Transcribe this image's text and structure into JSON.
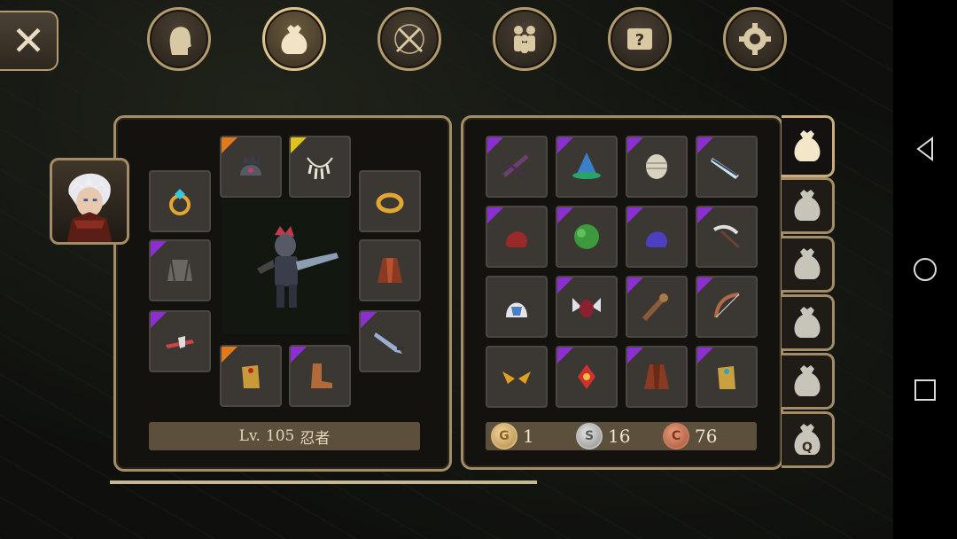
{
  "top_tabs": [
    {
      "name": "character-tab",
      "icon": "head-icon",
      "active": false
    },
    {
      "name": "inventory-tab",
      "icon": "bag-icon",
      "active": true
    },
    {
      "name": "skills-tab",
      "icon": "crossed-swords-icon",
      "active": false
    },
    {
      "name": "social-tab",
      "icon": "people-icon",
      "active": false
    },
    {
      "name": "quest-tab",
      "icon": "scroll-question-icon",
      "active": false
    },
    {
      "name": "settings-tab",
      "icon": "gear-icon",
      "active": false
    }
  ],
  "close_label": "✕",
  "character": {
    "level_prefix": "Lv.",
    "level": "105",
    "class_name": "忍者"
  },
  "equipment": [
    {
      "slot": "helmet",
      "icon": "spiked-helmet-icon",
      "rarity": "legend"
    },
    {
      "slot": "necklace",
      "icon": "claw-necklace-icon",
      "rarity": "unique"
    },
    {
      "slot": "ring-left",
      "icon": "gem-ring-icon",
      "rarity": "none"
    },
    {
      "slot": "ring-right",
      "icon": "gold-ring-icon",
      "rarity": "none"
    },
    {
      "slot": "armor",
      "icon": "chain-armor-icon",
      "rarity": "epic"
    },
    {
      "slot": "cloak",
      "icon": "red-cloak-icon",
      "rarity": "none"
    },
    {
      "slot": "weapon-left",
      "icon": "axe-icon",
      "rarity": "epic"
    },
    {
      "slot": "weapon-right",
      "icon": "greatsword-icon",
      "rarity": "epic"
    },
    {
      "slot": "gloves",
      "icon": "gauntlet-icon",
      "rarity": "legend"
    },
    {
      "slot": "boots",
      "icon": "boots-icon",
      "rarity": "epic"
    }
  ],
  "inventory": [
    {
      "icon": "dark-crossbow-icon",
      "rarity": "epic"
    },
    {
      "icon": "blue-wizard-hat-icon",
      "rarity": "epic"
    },
    {
      "icon": "bandage-helm-icon",
      "rarity": "epic"
    },
    {
      "icon": "ice-sword-icon",
      "rarity": "epic"
    },
    {
      "icon": "red-hood-icon",
      "rarity": "epic"
    },
    {
      "icon": "green-bush-icon",
      "rarity": "epic"
    },
    {
      "icon": "purple-hood-icon",
      "rarity": "epic"
    },
    {
      "icon": "scythe-icon",
      "rarity": "epic"
    },
    {
      "icon": "white-helm-icon",
      "rarity": "none"
    },
    {
      "icon": "winged-helm-icon",
      "rarity": "epic"
    },
    {
      "icon": "spiked-club-icon",
      "rarity": "epic"
    },
    {
      "icon": "bone-bow-icon",
      "rarity": "epic"
    },
    {
      "icon": "golden-wings-icon",
      "rarity": "none"
    },
    {
      "icon": "red-amulet-icon",
      "rarity": "epic"
    },
    {
      "icon": "leather-vest-icon",
      "rarity": "epic"
    },
    {
      "icon": "gold-gauntlet-icon",
      "rarity": "epic"
    }
  ],
  "bag_tabs": [
    {
      "icon": "bag-icon",
      "active": true,
      "label": ""
    },
    {
      "icon": "bag-icon",
      "active": false,
      "label": ""
    },
    {
      "icon": "bag-icon",
      "active": false,
      "label": ""
    },
    {
      "icon": "bag-icon",
      "active": false,
      "label": ""
    },
    {
      "icon": "bag-icon",
      "active": false,
      "label": ""
    },
    {
      "icon": "bag-icon",
      "active": false,
      "label": "Q"
    }
  ],
  "currency": {
    "gold": {
      "letter": "G",
      "amount": "1"
    },
    "silver": {
      "letter": "S",
      "amount": "16"
    },
    "copper": {
      "letter": "C",
      "amount": "76"
    }
  },
  "colors": {
    "epic": "#8b2fd1",
    "legend": "#e07b1c",
    "unique": "#e0c21c",
    "frame": "#a38c66"
  },
  "android_nav": [
    {
      "name": "back-button",
      "icon": "triangle-back-icon"
    },
    {
      "name": "home-button",
      "icon": "circle-home-icon"
    },
    {
      "name": "recents-button",
      "icon": "square-recents-icon"
    }
  ]
}
